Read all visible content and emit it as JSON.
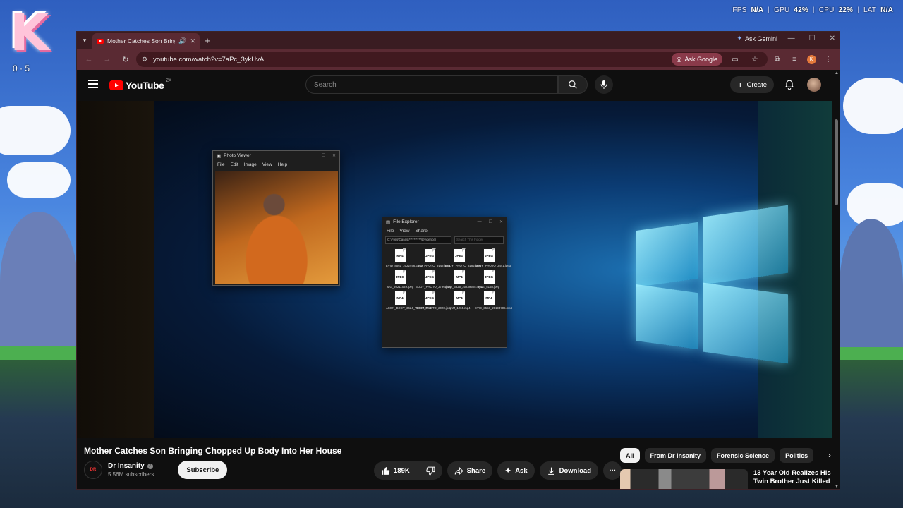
{
  "overlay": {
    "fps_label": "FPS",
    "fps_value": "N/A",
    "gpu_label": "GPU",
    "gpu_value": "42%",
    "cpu_label": "CPU",
    "cpu_value": "22%",
    "lat_label": "LAT",
    "lat_value": "N/A",
    "separator": "|"
  },
  "desktop": {
    "logo_letter": "K",
    "counter": "0 · 5"
  },
  "browser": {
    "tab_title": "Mother Catches Son Bringing Chopped Up Body Into Her House",
    "ask_gemini": "Ask Gemini",
    "url": "youtube.com/watch?v=7aPc_3ykUvA",
    "ask_google": "Ask Google",
    "profile_initial": "K"
  },
  "youtube": {
    "logo_text": "YouTube",
    "country_code": "ZA",
    "search_placeholder": "Search",
    "create_label": "Create"
  },
  "video_scene": {
    "photo_viewer": {
      "title": "Photo Viewer",
      "menu": [
        "File",
        "Edit",
        "Image",
        "View",
        "Help"
      ]
    },
    "file_explorer": {
      "title": "File Explorer",
      "menu": [
        "File",
        "View",
        "Share"
      ],
      "path": "C:\\Files\\Cases\\**********\\Evidence\\",
      "search_placeholder": "Search This Folder",
      "files": [
        {
          "type": "MP4",
          "name": "EVID_8561_20224961.mp4"
        },
        {
          "type": "JPEG",
          "name": "EVID_PHOTO_9148.jpeg"
        },
        {
          "type": "JPEG",
          "name": "BODY_PHOTO_3182.jpeg"
        },
        {
          "type": "JPEG",
          "name": "BODY_PHOTO_3441.jpeg"
        },
        {
          "type": "JPEG",
          "name": "IMG_20211049.jpeg"
        },
        {
          "type": "JPEG",
          "name": "BODY_PHOTO_3796.jpeg"
        },
        {
          "type": "MP4",
          "name": "EVID_3325_20239505.mp4"
        },
        {
          "type": "JPEG",
          "name": "FILE_5158.jpeg"
        },
        {
          "type": "MP4",
          "name": "AXON_BODY_3624_VIDEO.mp4"
        },
        {
          "type": "JPEG",
          "name": "BODY_PHOTO_2028.jpeg"
        },
        {
          "type": "MP4",
          "name": "CAM_1265.mp4"
        },
        {
          "type": "MP4",
          "name": "EVID_3558_20194706.mp4"
        }
      ]
    }
  },
  "video": {
    "title": "Mother Catches Son Bringing Chopped Up Body Into Her House",
    "channel_name": "Dr Insanity",
    "subscribers": "5.56M subscribers",
    "subscribe_label": "Subscribe",
    "likes": "189K",
    "share_label": "Share",
    "ask_label": "Ask",
    "download_label": "Download"
  },
  "sidebar": {
    "chips": [
      "All",
      "From Dr Insanity",
      "Forensic Science",
      "Politics"
    ],
    "recommendation_title": "13 Year Old Realizes His Twin Brother Just Killed"
  },
  "colors": {
    "tab_bar": "#3a1c22",
    "toolbar": "#5a2a33",
    "youtube_red": "#ff0000",
    "page_bg": "#0f0f0f"
  }
}
